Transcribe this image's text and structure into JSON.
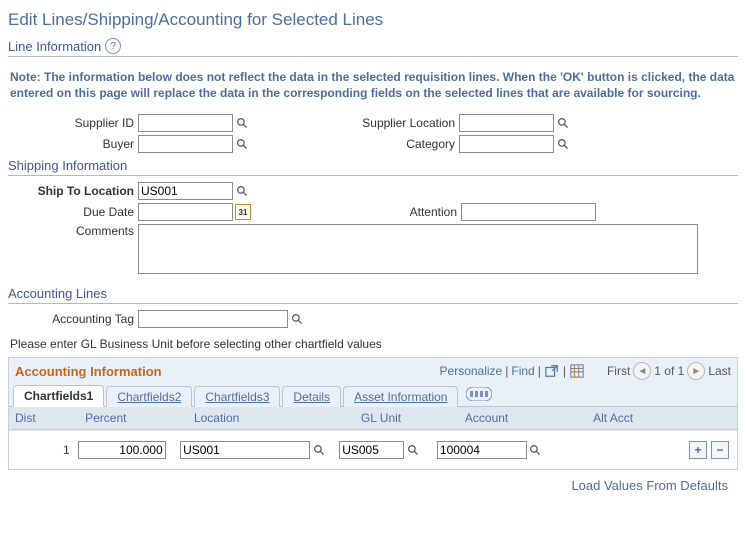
{
  "page_title": "Edit Lines/Shipping/Accounting for Selected Lines",
  "line_info": {
    "header": "Line Information",
    "note_label": "Note:",
    "note_text": "The information below does not reflect the data in the selected requisition lines. When the 'OK' button is clicked, the data entered on this page will replace the data in the corresponding fields on the selected lines that are available for sourcing.",
    "supplier_id": {
      "label": "Supplier ID",
      "value": ""
    },
    "supplier_location": {
      "label": "Supplier Location",
      "value": ""
    },
    "buyer": {
      "label": "Buyer",
      "value": ""
    },
    "category": {
      "label": "Category",
      "value": ""
    }
  },
  "shipping": {
    "header": "Shipping Information",
    "ship_to": {
      "label": "Ship To Location",
      "value": "US001"
    },
    "due_date": {
      "label": "Due Date",
      "value": ""
    },
    "attention": {
      "label": "Attention",
      "value": ""
    },
    "comments": {
      "label": "Comments",
      "value": ""
    }
  },
  "accounting": {
    "header": "Accounting Lines",
    "accounting_tag": {
      "label": "Accounting Tag",
      "value": ""
    },
    "hint": "Please enter GL Business Unit before selecting other chartfield values",
    "grid_title": "Accounting Information",
    "actions": {
      "personalize": "Personalize",
      "find": "Find",
      "first": "First",
      "pager": "1 of 1",
      "last": "Last"
    },
    "tabs": [
      {
        "label": "Chartfields1",
        "active": true
      },
      {
        "label": "Chartfields2",
        "active": false
      },
      {
        "label": "Chartfields3",
        "active": false
      },
      {
        "label": "Details",
        "active": false
      },
      {
        "label": "Asset Information",
        "active": false
      }
    ],
    "columns": {
      "dist": "Dist",
      "percent": "Percent",
      "location": "Location",
      "glunit": "GL Unit",
      "account": "Account",
      "altacct": "Alt Acct"
    },
    "rows": [
      {
        "dist": "1",
        "percent": "100.000",
        "location": "US001",
        "glunit": "US005",
        "account": "100004",
        "altacct": ""
      }
    ],
    "footer_link": "Load Values From Defaults"
  }
}
